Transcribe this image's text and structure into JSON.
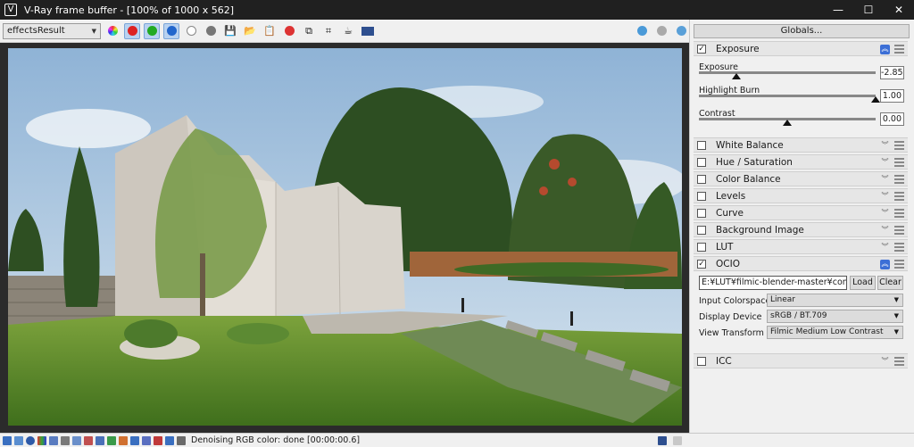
{
  "window": {
    "title": "V-Ray frame buffer - [100% of 1000 x 562]",
    "minimize": "—",
    "maximize": "☐",
    "close": "✕"
  },
  "toolbar": {
    "channel": "effectsResult"
  },
  "status": {
    "text": "Denoising RGB color: done [00:00:00.6]"
  },
  "panel": {
    "globals": "Globals...",
    "exposure": {
      "title": "Exposure",
      "checked": "✓",
      "sliders": [
        {
          "label": "Exposure",
          "value": "-2.85",
          "position": 0.21
        },
        {
          "label": "Highlight Burn",
          "value": "1.00",
          "position": 1.0
        },
        {
          "label": "Contrast",
          "value": "0.00",
          "position": 0.5
        }
      ]
    },
    "sections": [
      "White Balance",
      "Hue / Saturation",
      "Color Balance",
      "Levels",
      "Curve",
      "Background Image",
      "LUT"
    ],
    "ocio": {
      "title": "OCIO",
      "checked": "✓",
      "path": "E:¥LUT¥filmic-blender-master¥config.oc",
      "load": "Load",
      "clear": "Clear",
      "input_label": "Input Colorspace",
      "input_value": "Linear",
      "display_label": "Display Device",
      "display_value": "sRGB / BT.709",
      "view_label": "View Transform",
      "view_value": "Filmic Medium Low Contrast"
    },
    "icc": "ICC"
  }
}
